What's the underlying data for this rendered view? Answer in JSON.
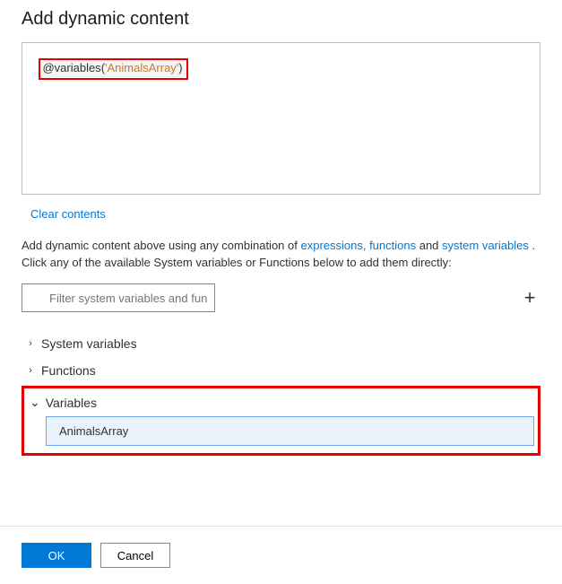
{
  "title": "Add dynamic content",
  "expression": {
    "at": "@",
    "fn": "variables",
    "open": "(",
    "str": "'AnimalsArray'",
    "close": ")"
  },
  "clear_label": "Clear contents",
  "helper": {
    "pre": "Add dynamic content above using any combination of ",
    "link1": "expressions, functions",
    "mid": " and ",
    "link2": "system variables",
    "post": " . Click any of the available System variables or Functions below to add them directly:"
  },
  "filter": {
    "placeholder": "Filter system variables and functions..."
  },
  "sections": {
    "system": "System variables",
    "functions": "Functions",
    "variables": "Variables"
  },
  "var_items": [
    "AnimalsArray"
  ],
  "buttons": {
    "ok": "OK",
    "cancel": "Cancel"
  },
  "icons": {
    "chev_right": "›",
    "chev_down": "⌄",
    "plus": "+",
    "search": "⌕"
  }
}
